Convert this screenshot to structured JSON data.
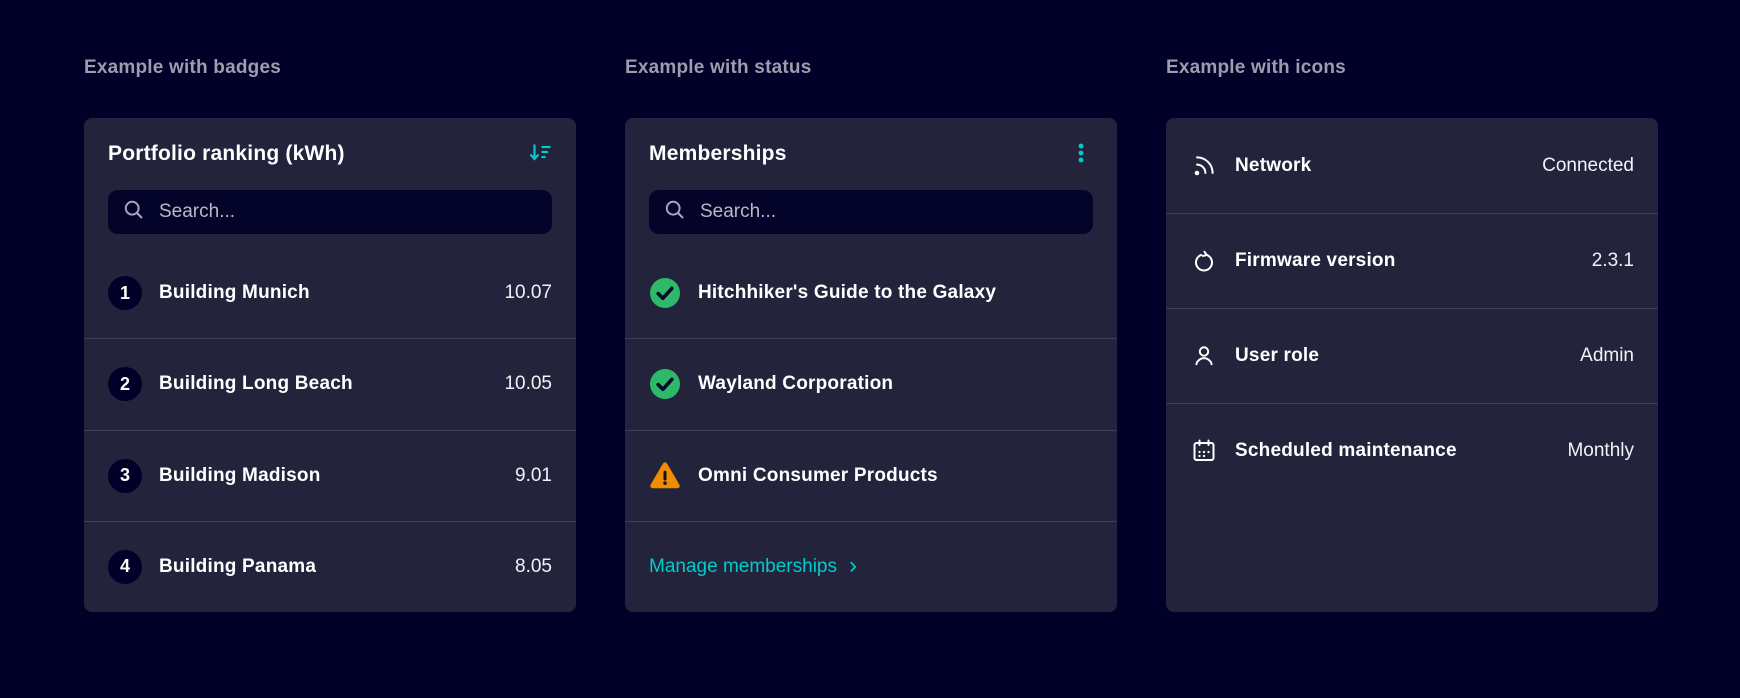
{
  "colors": {
    "background": "#000028",
    "card": "#23233C",
    "accent_teal": "#00CCCC",
    "success_green": "#2EB869",
    "warning_orange": "#F08C00",
    "heading_grey": "#9d9dac",
    "divider": "#3f3f5c"
  },
  "sections": [
    {
      "heading": "Example with badges",
      "card": {
        "title": "Portfolio ranking (kWh)",
        "header_icon": "sort-descending-icon",
        "search": {
          "placeholder": "Search..."
        },
        "items": [
          {
            "badge": "1",
            "label": "Building Munich",
            "value": "10.07"
          },
          {
            "badge": "2",
            "label": "Building Long Beach",
            "value": "10.05"
          },
          {
            "badge": "3",
            "label": "Building Madison",
            "value": "9.01"
          },
          {
            "badge": "4",
            "label": "Building Panama",
            "value": "8.05"
          }
        ]
      }
    },
    {
      "heading": "Example with status",
      "card": {
        "title": "Memberships",
        "header_icon": "kebab-menu-icon",
        "search": {
          "placeholder": "Search..."
        },
        "items": [
          {
            "status": "success",
            "status_icon": "check-circle-icon",
            "label": "Hitchhiker's Guide to the Galaxy"
          },
          {
            "status": "success",
            "status_icon": "check-circle-icon",
            "label": "Wayland Corporation"
          },
          {
            "status": "warning",
            "status_icon": "warning-triangle-icon",
            "label": "Omni Consumer Products"
          }
        ],
        "footer_link": {
          "label": "Manage memberships",
          "chevron": "›"
        }
      }
    },
    {
      "heading": "Example with icons",
      "card": {
        "items": [
          {
            "icon": "network-signal-icon",
            "label": "Network",
            "value": "Connected"
          },
          {
            "icon": "firmware-refresh-icon",
            "label": "Firmware version",
            "value": "2.3.1"
          },
          {
            "icon": "user-icon",
            "label": "User role",
            "value": "Admin"
          },
          {
            "icon": "calendar-icon",
            "label": "Scheduled maintenance",
            "value": "Monthly"
          }
        ]
      }
    }
  ]
}
